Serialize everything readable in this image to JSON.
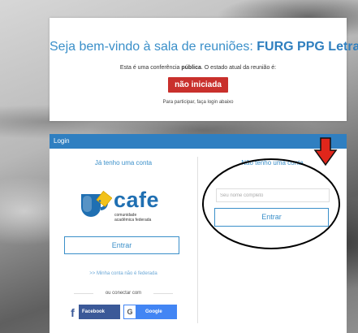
{
  "welcome": {
    "title_prefix": "Seja bem-vindo à sala de reuniões:",
    "title_room": "FURG PPG Letras",
    "status_prefix": "Esta é uma conferência",
    "status_public": "pública",
    "status_suffix": ". O estado atual da reunião é:",
    "state_badge": "não iniciada",
    "hint": "Para participar, faça login abaixo"
  },
  "login": {
    "header": "Login",
    "left": {
      "heading": "Já tenho uma conta",
      "logo_word": "cafe",
      "logo_sub1": "comunidade",
      "logo_sub2": "acadêmica federada",
      "enter_button": "Entrar",
      "not_federated_link": ">> Minha conta não é federada",
      "or_connect": "ou conectar com",
      "facebook_button": "Facebook",
      "google_button": "Google"
    },
    "right": {
      "heading": "Não tenho uma conta",
      "name_placeholder": "Seu nome completo",
      "name_value": "",
      "enter_button": "Entrar"
    }
  },
  "colors": {
    "accent": "#3a8fc9",
    "header_bar": "#2f7fc1",
    "badge": "#c9302c",
    "facebook": "#3b5998",
    "google": "#4285f4",
    "annotation_arrow": "#e0261b"
  },
  "icons": {
    "logo": "cafe-cup-logo",
    "facebook": "facebook-f-icon",
    "google": "google-g-icon",
    "annotation": "red-down-arrow"
  }
}
